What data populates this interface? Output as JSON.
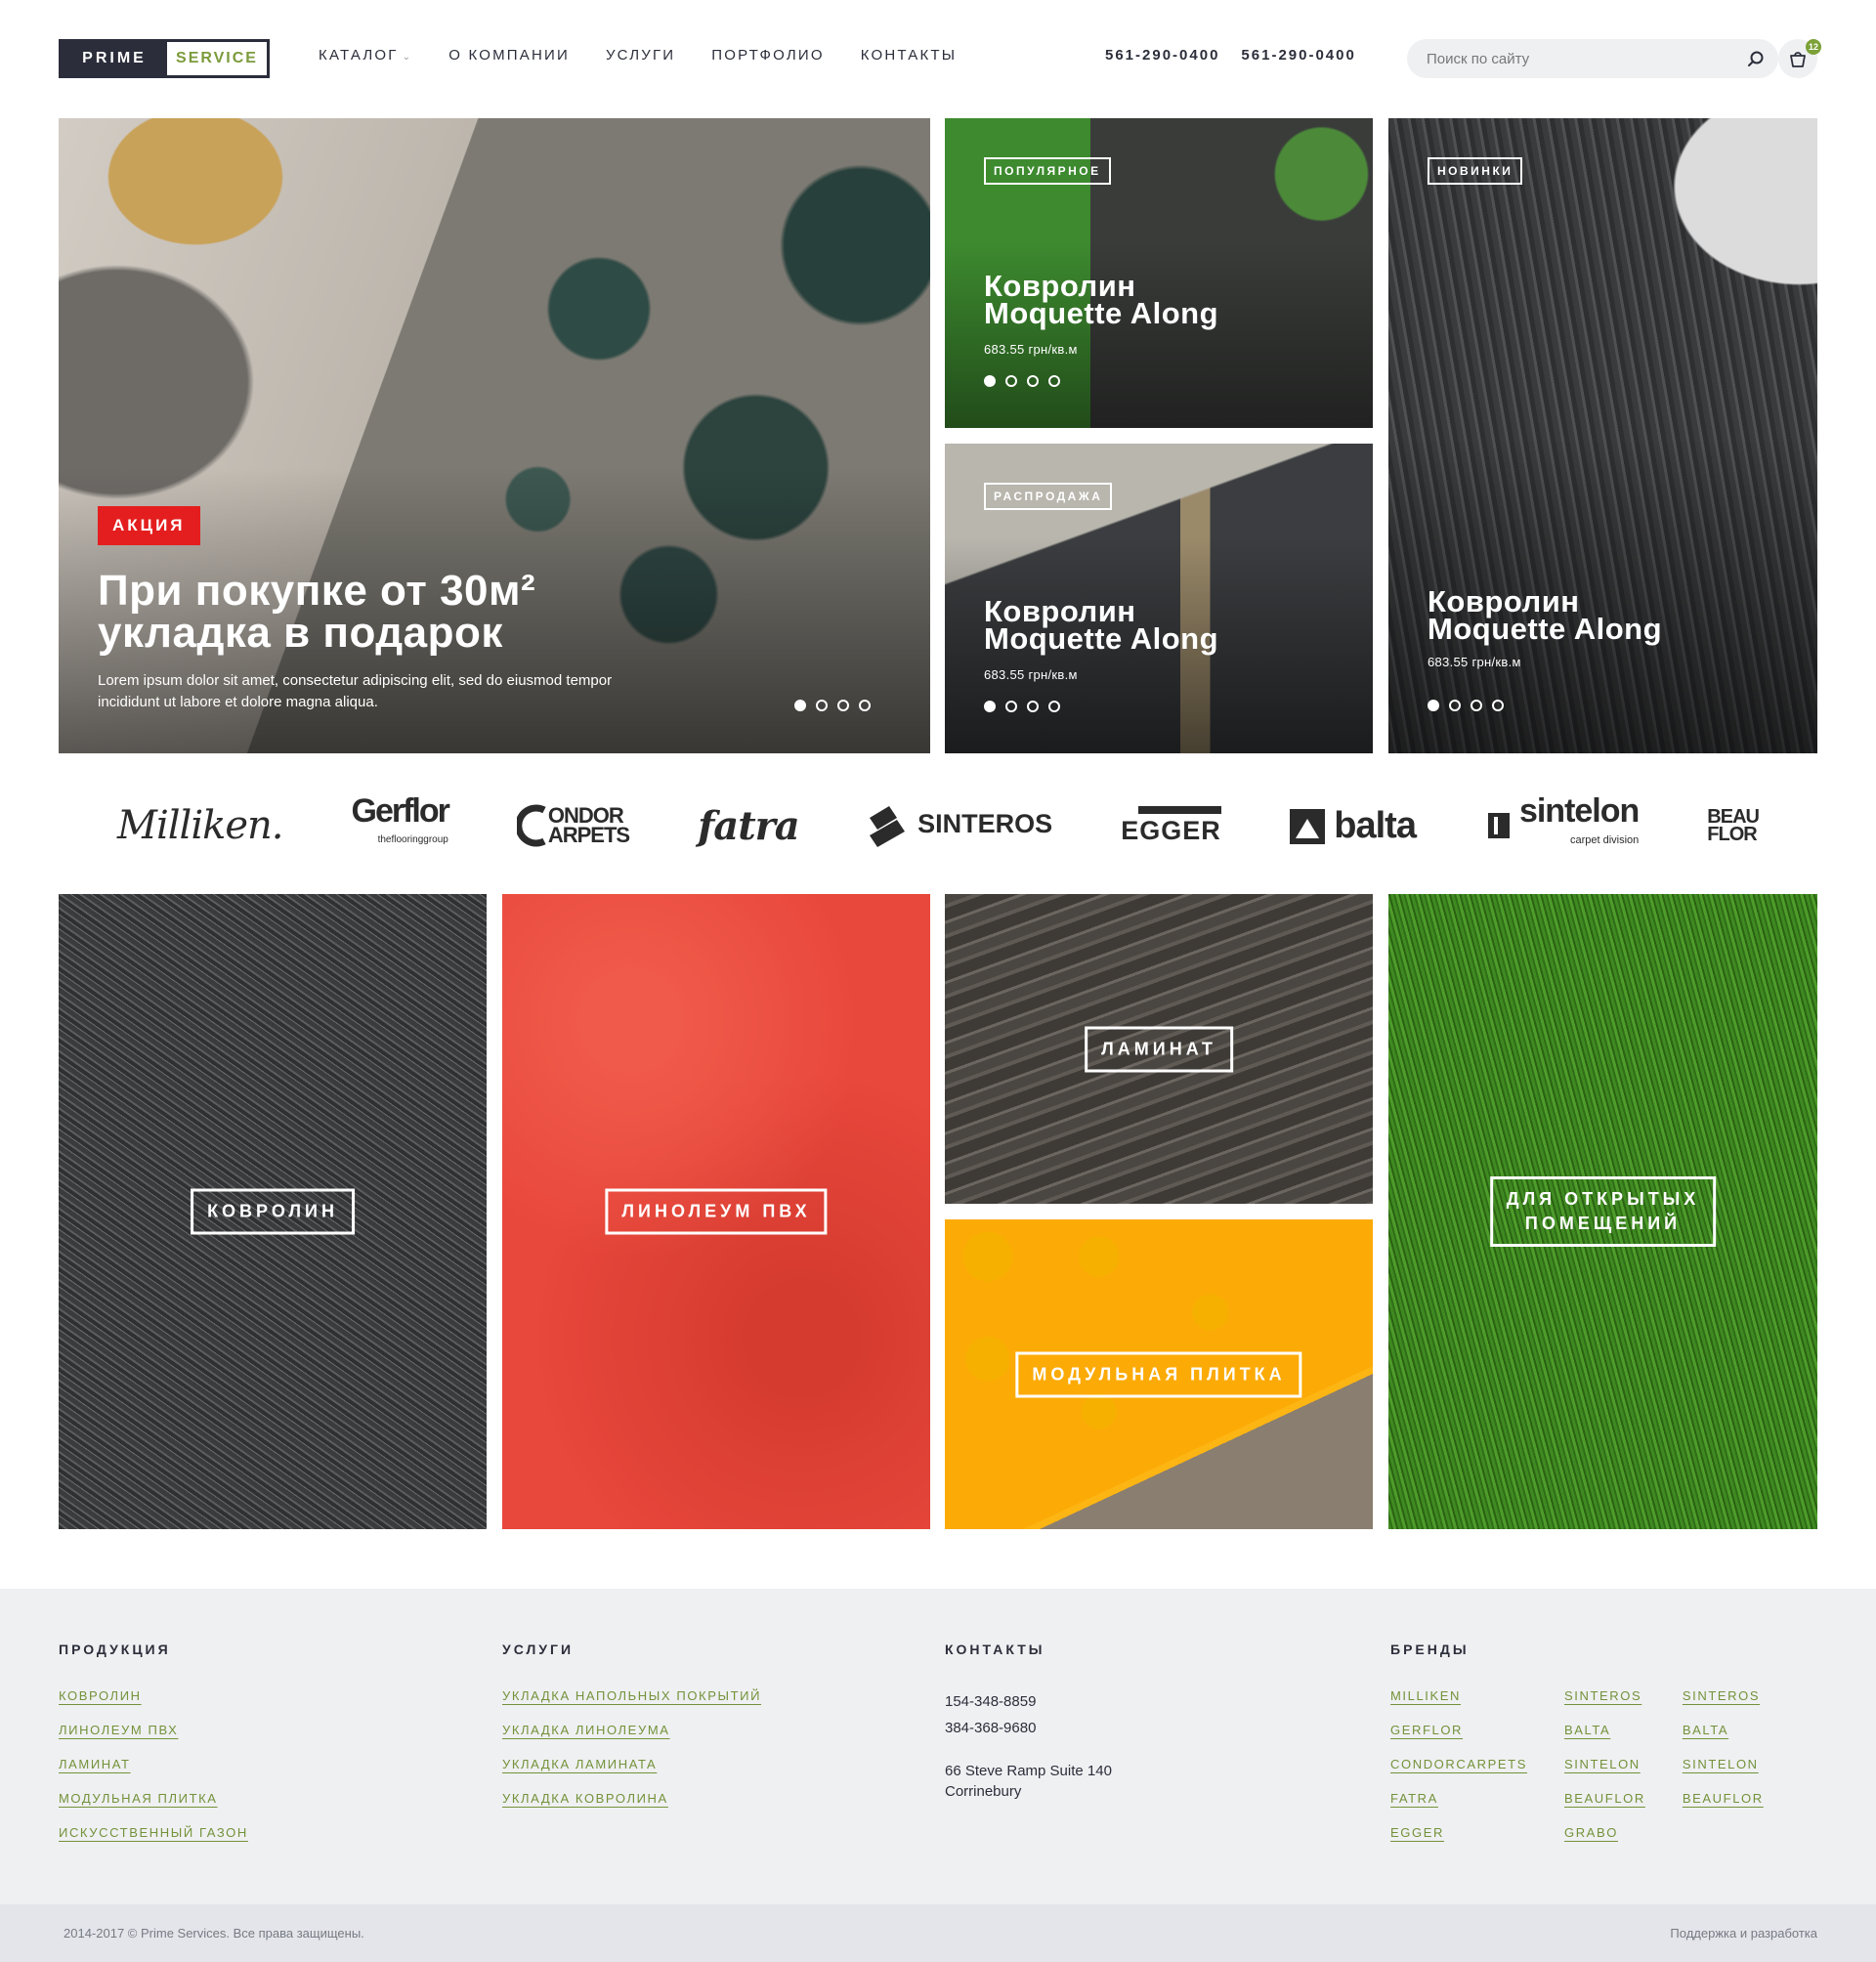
{
  "header": {
    "logo": {
      "left": "PRIME",
      "right": "SERVICE"
    },
    "nav": [
      {
        "label": "КАТАЛОГ"
      },
      {
        "label": "О КОМПАНИИ"
      },
      {
        "label": "УСЛУГИ"
      },
      {
        "label": "ПОРТФОЛИО"
      },
      {
        "label": "КОНТАКТЫ"
      }
    ],
    "phones": [
      "561-290-0400",
      "561-290-0400"
    ],
    "search": {
      "placeholder": "Поиск по сайту",
      "icon": "search-icon"
    },
    "cart": {
      "icon": "cart-icon",
      "count": "12"
    }
  },
  "hero": {
    "main": {
      "badge": "АКЦИЯ",
      "title_line1": "При покупке от 30м²",
      "title_line2": "укладка в подарок",
      "text_line1": "Lorem ipsum dolor sit amet, consectetur adipiscing elit, sed do eiusmod tempor",
      "text_line2": "incididunt ut labore et dolore magna aliqua."
    },
    "cards": [
      {
        "badge": "ПОПУЛЯРНОЕ",
        "title_line1": "Ковролин",
        "title_line2": "Moquette Along",
        "price": "683.55 грн/кв.м"
      },
      {
        "badge": "РАСПРОДАЖА",
        "title_line1": "Ковролин",
        "title_line2": "Moquette Along",
        "price": "683.55 грн/кв.м"
      },
      {
        "badge": "НОВИНКИ",
        "title_line1": "Ковролин",
        "title_line2": "Moquette Along",
        "price": "683.55 грн/кв.м"
      }
    ]
  },
  "brands": {
    "milliken": "Milliken.",
    "gerflor": "Gerflor",
    "gerflor_sub": "theflooringgroup",
    "condor_line1": "ONDOR",
    "condor_line2": "ARPETS",
    "fatra": "fatra",
    "sinteros": "SINTEROS",
    "egger": "EGGER",
    "balta": "balta",
    "sintelon": "sintelon",
    "sintelon_sub": "carpet division",
    "beauflor_line1": "BEAU",
    "beauflor_line2": "FLOR"
  },
  "categories": {
    "carpet": "КОВРОЛИН",
    "lino": "ЛИНОЛЕУМ ПВХ",
    "laminate": "ЛАМИНАТ",
    "tile": "МОДУЛЬНАЯ ПЛИТКА",
    "grass_line1": "ДЛЯ ОТКРЫТЫХ",
    "grass_line2": "ПОМЕЩЕНИЙ"
  },
  "footer": {
    "products": {
      "heading": "ПРОДУКЦИЯ",
      "links": [
        "КОВРОЛИН",
        "ЛИНОЛЕУМ ПВХ",
        "ЛАМИНАТ",
        "МОДУЛЬНАЯ ПЛИТКА",
        "ИСКУССТВЕННЫЙ ГАЗОН"
      ]
    },
    "services": {
      "heading": "УСЛУГИ",
      "links": [
        "УКЛАДКА НАПОЛЬНЫХ ПОКРЫТИЙ",
        "УКЛАДКА ЛИНОЛЕУМА",
        "УКЛАДКА ЛАМИНАТА",
        "УКЛАДКА КОВРОЛИНА"
      ]
    },
    "contacts": {
      "heading": "КОНТАКТЫ",
      "phone1": "154-348-8859",
      "phone2": "384-368-9680",
      "address_line1": "66 Steve Ramp Suite 140",
      "address_line2": "Corrinebury"
    },
    "brands": {
      "heading": "БРЕНДЫ",
      "col1": [
        "MILLIKEN",
        "GERFLOR",
        "CONDORCARPETS",
        "FATRA",
        "EGGER"
      ],
      "col2": [
        "SINTEROS",
        "BALTA",
        "SINTELON",
        "BEAUFLOR",
        "GRABO"
      ],
      "col3": [
        "SINTEROS",
        "BALTA",
        "SINTELON",
        "BEAUFLOR"
      ]
    },
    "copyright": "2014-2017 © Prime Services. Все права защищены.",
    "support": "Поддержка и разработка"
  },
  "colors": {
    "accent_green": "#74923a",
    "badge_red": "#e41e1e",
    "dark": "#2b2d3b",
    "footer_bg": "#eff0f2"
  }
}
